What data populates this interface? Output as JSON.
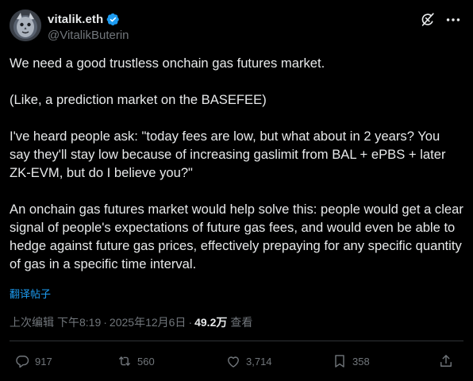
{
  "author": {
    "display_name": "vitalik.eth",
    "handle": "@VitalikButerin",
    "verified": true
  },
  "tweet": {
    "paragraphs": [
      "We need a good trustless onchain gas futures market.",
      "(Like, a prediction market on the BASEFEE)",
      "I've heard people ask: \"today fees are low, but what about in 2 years? You say they'll stay low because of increasing gaslimit from BAL + ePBS + later ZK-EVM, but do I believe you?\"",
      "An onchain gas futures market would help solve this: people would get a clear signal of people's expectations of future gas fees, and would even be able to hedge against future gas prices, effectively prepaying for any specific quantity of gas in a specific time interval."
    ],
    "translate_label": "翻译帖子"
  },
  "meta": {
    "edited_label": "上次编辑",
    "time": "下午8:19",
    "separator": "·",
    "date": "2025年12月6日",
    "views_count": "49.2万",
    "views_label": "查看"
  },
  "actions": {
    "replies": "917",
    "reposts": "560",
    "likes": "3,714",
    "bookmarks": "358"
  },
  "icons": {
    "verified": "verified-badge-icon",
    "grok": "grok-icon",
    "more": "more-icon",
    "reply": "reply-icon",
    "repost": "repost-icon",
    "like": "like-icon",
    "bookmark": "bookmark-icon",
    "share": "share-icon"
  },
  "colors": {
    "background": "#000000",
    "text": "#e7e9ea",
    "secondary": "#71767b",
    "accent": "#1d9bf0",
    "divider": "#2f3336"
  }
}
